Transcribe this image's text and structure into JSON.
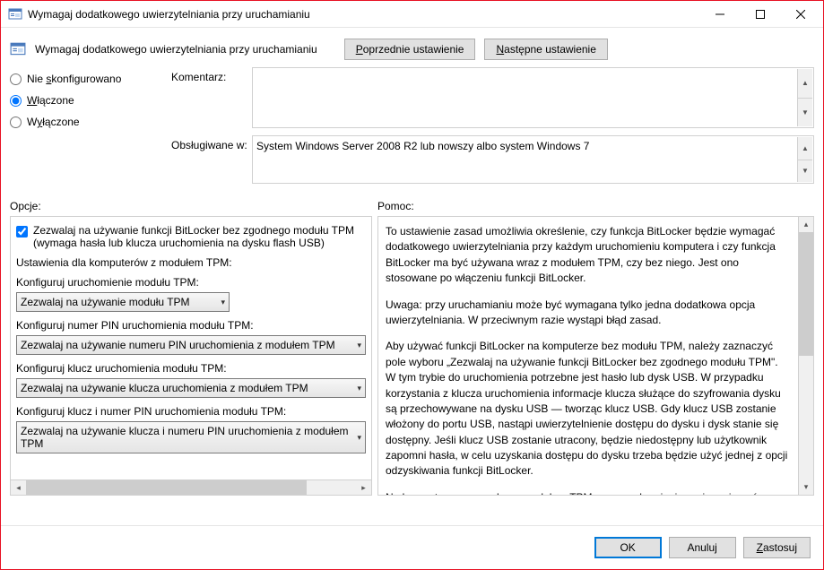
{
  "titlebar": {
    "title": "Wymagaj dodatkowego uwierzytelniania przy uruchamianiu"
  },
  "header": {
    "title": "Wymagaj dodatkowego uwierzytelniania przy uruchamianiu",
    "prev_btn": "Poprzednie ustawienie",
    "next_btn": "Następne ustawienie"
  },
  "state": {
    "not_configured": "Nie skonfigurowano",
    "enabled": "Włączone",
    "disabled": "Wyłączone"
  },
  "fields": {
    "comment_label": "Komentarz:",
    "supported_label": "Obsługiwane w:",
    "supported_text": "System Windows Server 2008 R2 lub nowszy albo system Windows 7"
  },
  "sections": {
    "options": "Opcje:",
    "help": "Pomoc:"
  },
  "options": {
    "allow_without_tpm": "Zezwalaj na używanie funkcji BitLocker bez zgodnego modułu TPM (wymaga hasła lub klucza uruchomienia na dysku flash USB)",
    "tpm_settings_label": "Ustawienia dla komputerów z modułem TPM:",
    "configure_tpm_startup": "Konfiguruj uruchomienie modułu TPM:",
    "combo_tpm_startup": "Zezwalaj na używanie modułu TPM",
    "configure_pin": "Konfiguruj numer PIN uruchomienia modułu TPM:",
    "combo_pin": "Zezwalaj na używanie numeru PIN uruchomienia z modułem TPM",
    "configure_key": "Konfiguruj klucz uruchomienia modułu TPM:",
    "combo_key": "Zezwalaj na używanie klucza uruchomienia z modułem TPM",
    "configure_key_pin": "Konfiguruj klucz i numer PIN uruchomienia modułu TPM:",
    "combo_key_pin": "Zezwalaj na używanie klucza i numeru PIN uruchomienia z modułem TPM"
  },
  "help": {
    "p1": "To ustawienie zasad umożliwia określenie, czy funkcja BitLocker będzie wymagać dodatkowego uwierzytelniania przy każdym uruchomieniu komputera i czy funkcja BitLocker ma być używana wraz z modułem TPM, czy bez niego. Jest ono stosowane po włączeniu funkcji BitLocker.",
    "p2": "Uwaga: przy uruchamianiu może być wymagana tylko jedna dodatkowa opcja uwierzytelniania. W przeciwnym razie wystąpi błąd zasad.",
    "p3": "Aby używać funkcji BitLocker na komputerze bez modułu TPM, należy zaznaczyć pole wyboru „Zezwalaj na używanie funkcji BitLocker bez zgodnego modułu TPM\". W tym trybie do uruchomienia potrzebne jest hasło lub dysk USB. W przypadku korzystania z klucza uruchomienia informacje klucza służące do szyfrowania dysku są przechowywane na dysku USB — tworząc klucz USB. Gdy klucz USB zostanie włożony do portu USB, nastąpi uwierzytelnienie dostępu do dysku i dysk stanie się dostępny. Jeśli klucz USB zostanie utracony, będzie niedostępny lub użytkownik zapomni hasła, w celu uzyskania dostępu do dysku trzeba będzie użyć jednej z opcji odzyskiwania funkcji BitLocker.",
    "p4": "Na komputerze ze zgodnym modułem TPM przy uruchamianiu można używać czterech typów metod uwierzytelniania, aby zapewnić dodatkową ochronę szyfrowanych danych. Podczas uruchamiania komputera do uwierzytelnienia można użyć tylko modułu TPM lub wymagać dodatkowo włożenia dysku flash USB zawierającego klucz uruchomienia,"
  },
  "footer": {
    "ok": "OK",
    "cancel": "Anuluj",
    "apply": "Zastosuj"
  }
}
